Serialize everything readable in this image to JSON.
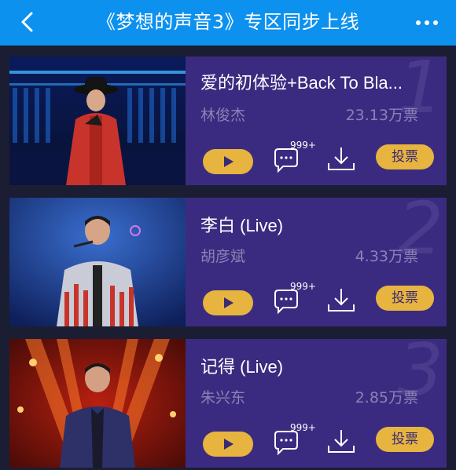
{
  "header": {
    "title": "《梦想的声音3》专区同步上线",
    "back_icon": "chevron-left-icon",
    "more_icon": "more-dots-icon"
  },
  "songs": [
    {
      "rank": "1",
      "title": "爱的初体验+Back To Bla...",
      "artist": "林俊杰",
      "votes": "23.13万票",
      "comment_count": "999+",
      "vote_label": "投票"
    },
    {
      "rank": "2",
      "title": "李白 (Live)",
      "artist": "胡彦斌",
      "votes": "4.33万票",
      "comment_count": "999+",
      "vote_label": "投票"
    },
    {
      "rank": "3",
      "title": "记得 (Live)",
      "artist": "朱兴东",
      "votes": "2.85万票",
      "comment_count": "999+",
      "vote_label": "投票"
    }
  ],
  "colors": {
    "header_bg": "#0d91ee",
    "card_bg": "#3b2b80",
    "accent": "#e6b43f",
    "page_bg": "#1b1d33"
  }
}
